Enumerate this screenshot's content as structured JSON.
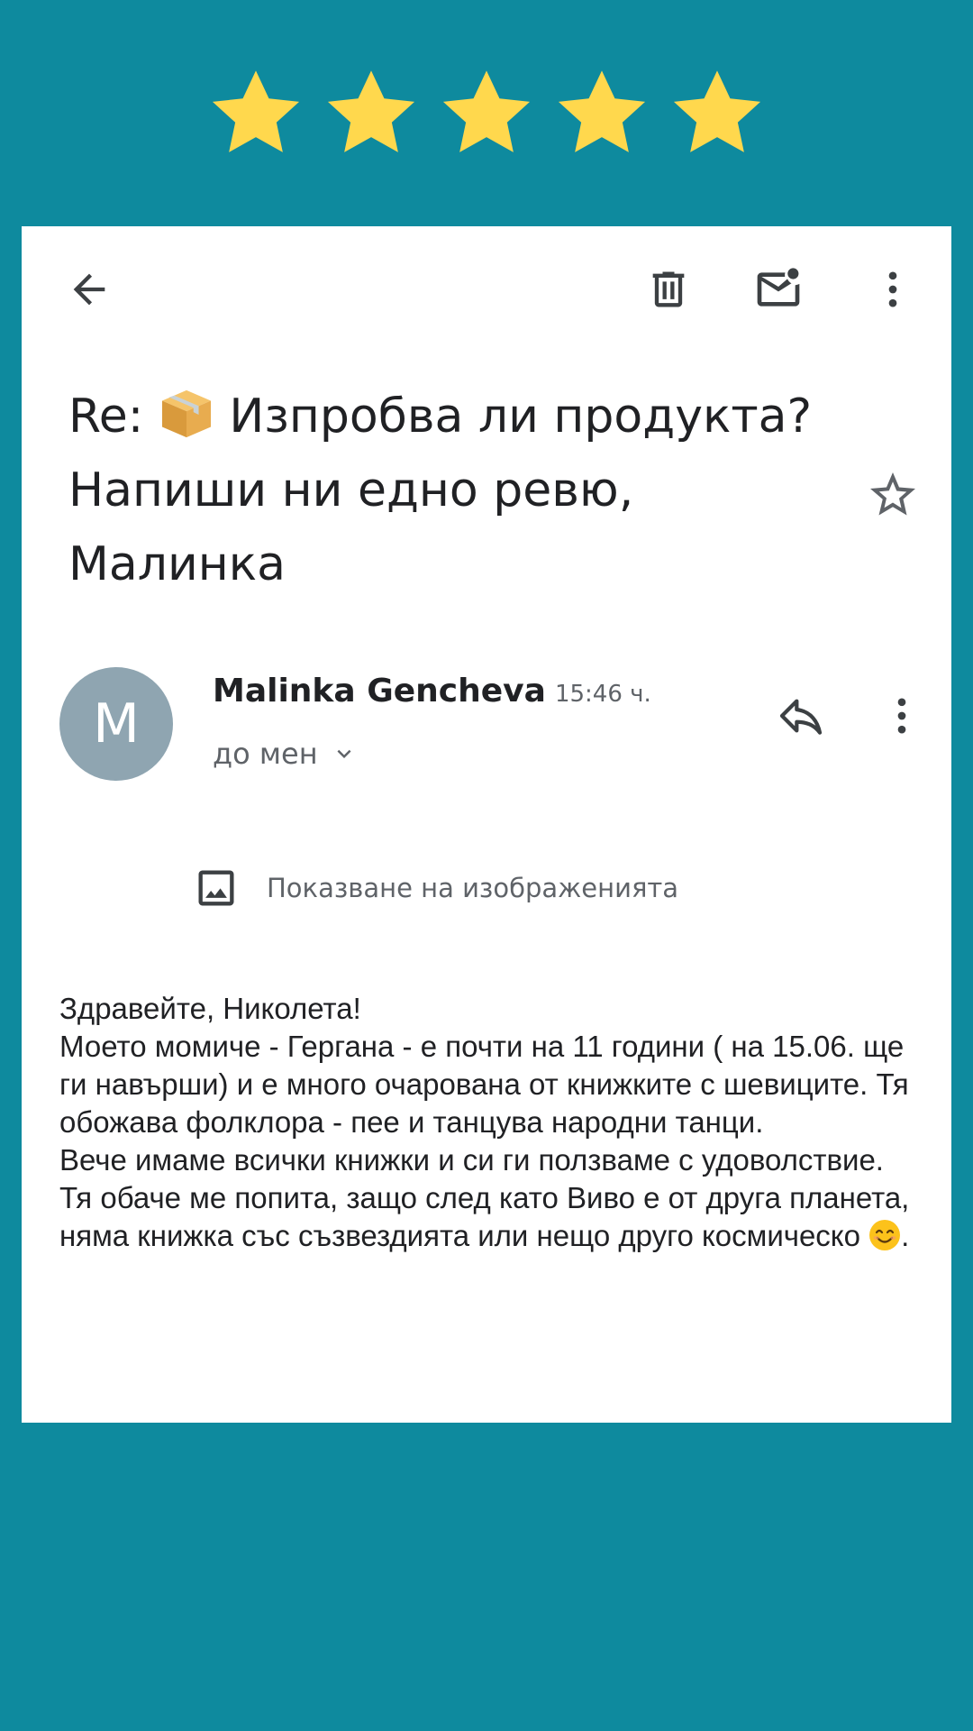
{
  "rating": {
    "value": 5,
    "max": 5,
    "color": "#ffd84d"
  },
  "colors": {
    "background": "#0e8a9e",
    "card": "#ffffff",
    "avatar": "#8fa5b1"
  },
  "toolbar": {
    "back_icon": "arrow-left-icon",
    "delete_icon": "trash-icon",
    "mark_unread_icon": "mail-unread-icon",
    "more_icon": "more-vert-icon"
  },
  "email": {
    "subject_prefix": "Re:",
    "subject_emoji": "package-emoji",
    "subject_rest": "Изпробва ли продукта?\nНапиши ни едно ревю,\nМалинка",
    "sender": {
      "initial": "M",
      "name": "Malinka Gencheva",
      "time": "15:46 ч.",
      "recipient": "до мен"
    },
    "show_images_label": "Показване на изображенията",
    "body": {
      "line1": "Здравейте, Николета!",
      "line2": "Моето момиче - Гергана - е почти на 11 години ( на 15.06. ще ги навърши) и е много очарована от книжките с шевиците. Тя обожава фолклора - пее и танцува народни танци.",
      "line3": "Вече имаме всички книжки и си ги ползваме с удоволствие.",
      "line4_text": "Тя обаче ме попита, защо след като Виво е от друга планета, няма книжка със съзвездията или нещо друго космическо",
      "line4_end": "."
    }
  }
}
